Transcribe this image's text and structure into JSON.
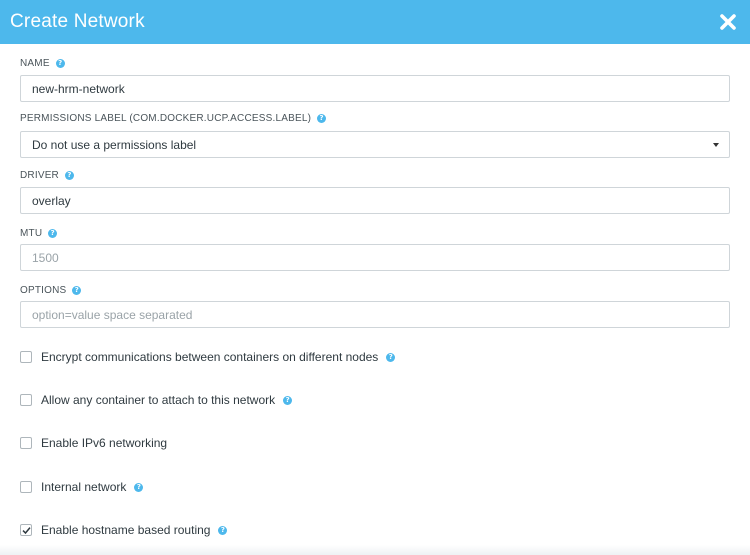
{
  "dialog": {
    "title": "Create Network",
    "close_icon": "close-icon"
  },
  "fields": {
    "name": {
      "label": "NAME",
      "value": "new-hrm-network",
      "placeholder": ""
    },
    "permissions": {
      "label": "PERMISSIONS LABEL (COM.DOCKER.UCP.ACCESS.LABEL)",
      "selected": "Do not use a permissions label"
    },
    "driver": {
      "label": "DRIVER",
      "value": "overlay"
    },
    "mtu": {
      "label": "MTU",
      "placeholder": "1500"
    },
    "options": {
      "label": "OPTIONS",
      "placeholder": "option=value space separated"
    }
  },
  "checkboxes": [
    {
      "label": "Encrypt communications between containers on different nodes",
      "checked": false,
      "help": true
    },
    {
      "label": "Allow any container to attach to this network",
      "checked": false,
      "help": true
    },
    {
      "label": "Enable IPv6 networking",
      "checked": false,
      "help": false
    },
    {
      "label": "Internal network",
      "checked": false,
      "help": true
    },
    {
      "label": "Enable hostname based routing",
      "checked": true,
      "help": true
    }
  ],
  "colors": {
    "accent": "#4db8ec",
    "text": "#2f3a40",
    "border": "#cfd5d9"
  },
  "help_icon": "help-icon",
  "help_glyph": "?"
}
